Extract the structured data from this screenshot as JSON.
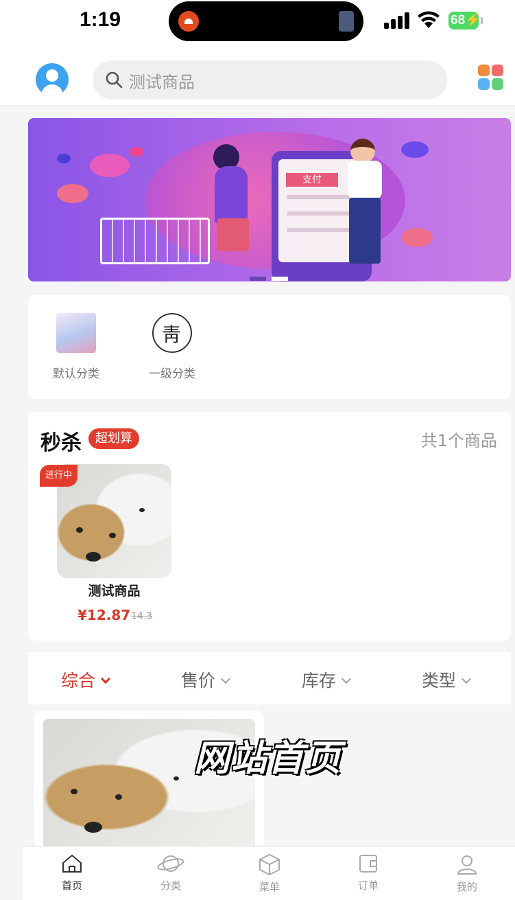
{
  "status_bar": {
    "time": "1:19",
    "battery": "68"
  },
  "search": {
    "placeholder": "测试商品"
  },
  "categories": [
    {
      "label": "默认分类"
    },
    {
      "label": "一级分类"
    }
  ],
  "flash_sale": {
    "title": "秒杀",
    "tag": "超划算",
    "count_text": "共1个商品",
    "product": {
      "badge": "进行中",
      "name": "测试商品",
      "price": "¥12.87",
      "original_price": "14.3"
    }
  },
  "sort_bar": {
    "items": [
      {
        "label": "综合",
        "active": true
      },
      {
        "label": "售价",
        "active": false
      },
      {
        "label": "库存",
        "active": false
      },
      {
        "label": "类型",
        "active": false
      }
    ]
  },
  "banner": {
    "pay_text": "支付"
  },
  "overlay_caption": "网站首页",
  "tab_bar": {
    "items": [
      {
        "label": "首页",
        "icon": "home-icon",
        "active": true
      },
      {
        "label": "分类",
        "icon": "planet-icon",
        "active": false
      },
      {
        "label": "菜单",
        "icon": "cube-icon",
        "active": false
      },
      {
        "label": "订单",
        "icon": "wallet-icon",
        "active": false
      },
      {
        "label": "我的",
        "icon": "user-icon",
        "active": false
      }
    ]
  },
  "colors": {
    "accent": "#d8392c",
    "tag_red": "#e23c2d",
    "avatar_blue": "#3ea3ee"
  }
}
